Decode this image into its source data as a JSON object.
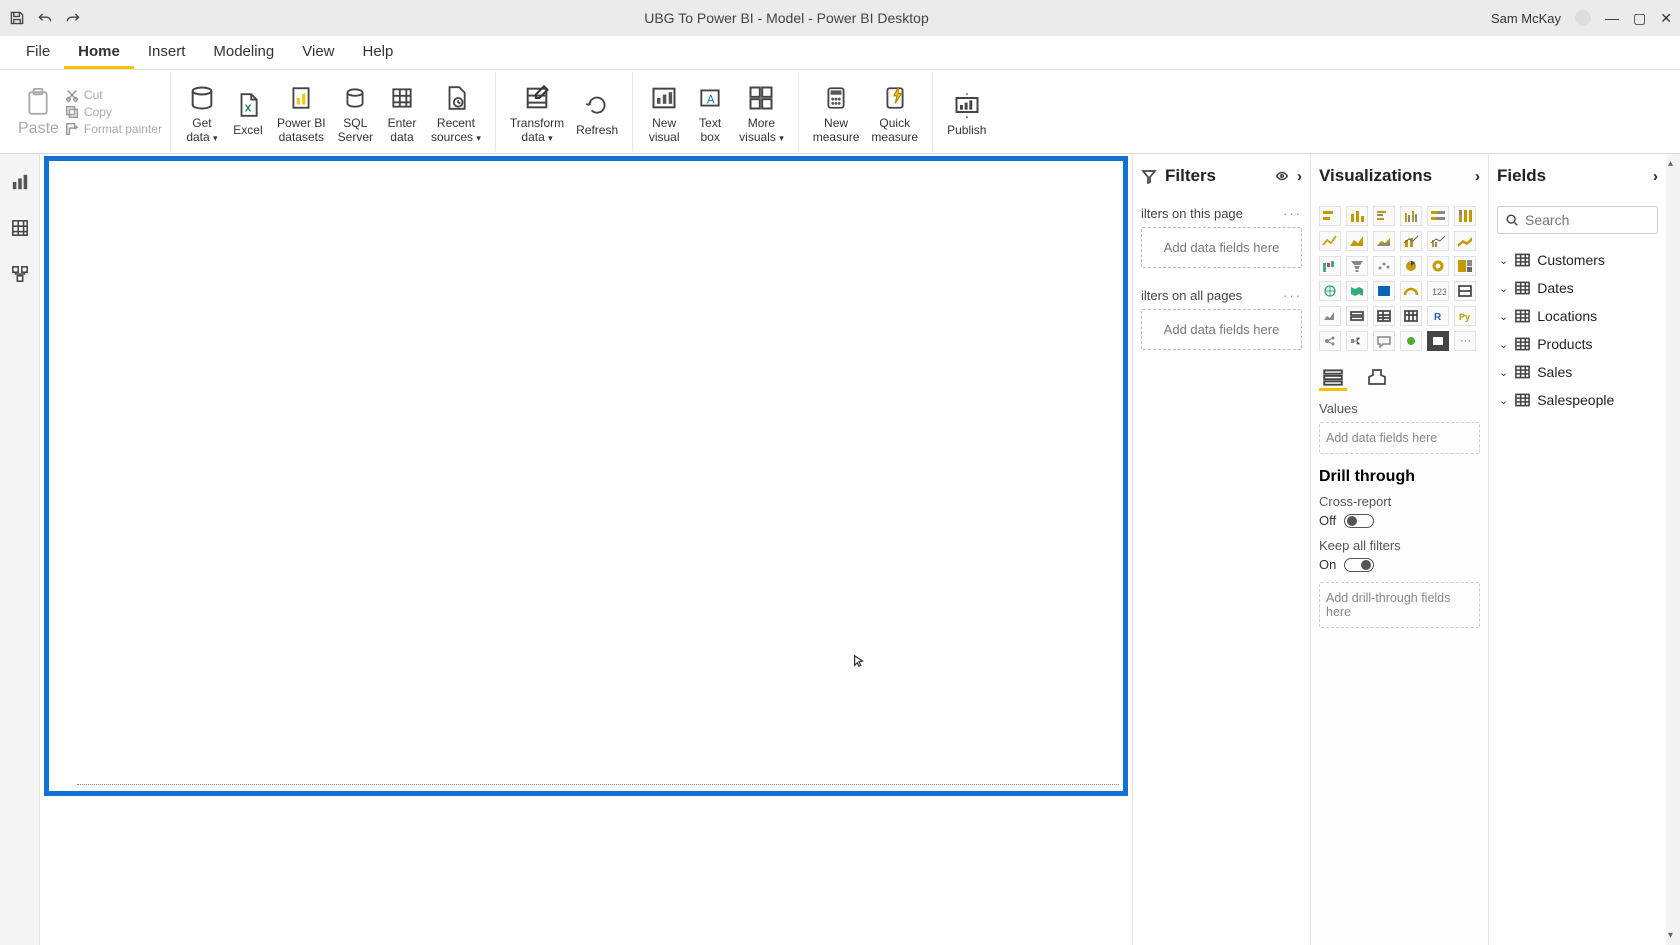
{
  "titlebar": {
    "title": "UBG To Power BI - Model - Power BI Desktop",
    "user": "Sam McKay"
  },
  "menu": {
    "tabs": [
      "File",
      "Home",
      "Insert",
      "Modeling",
      "View",
      "Help"
    ],
    "active": "Home"
  },
  "ribbon": {
    "paste": "Paste",
    "cut": "Cut",
    "copy": "Copy",
    "format_painter": "Format painter",
    "get_data": "Get\ndata",
    "excel": "Excel",
    "pbi_datasets": "Power BI\ndatasets",
    "sql_server": "SQL\nServer",
    "enter_data": "Enter\ndata",
    "recent_sources": "Recent\nsources",
    "transform_data": "Transform\ndata",
    "refresh": "Refresh",
    "new_visual": "New\nvisual",
    "text_box": "Text\nbox",
    "more_visuals": "More\nvisuals",
    "new_measure": "New\nmeasure",
    "quick_measure": "Quick\nmeasure",
    "publish": "Publish"
  },
  "filters": {
    "title": "Filters",
    "page_label": "ilters on this page",
    "add_here": "Add data fields here",
    "all_label": "ilters on all pages"
  },
  "viz": {
    "title": "Visualizations",
    "values_label": "Values",
    "add_here": "Add data fields here",
    "drill_title": "Drill through",
    "cross_report": "Cross-report",
    "cross_state": "Off",
    "keep_filters": "Keep all filters",
    "keep_state": "On",
    "drill_slot": "Add drill-through fields here"
  },
  "fields": {
    "title": "Fields",
    "search_placeholder": "Search",
    "tables": [
      "Customers",
      "Dates",
      "Locations",
      "Products",
      "Sales",
      "Salespeople"
    ]
  }
}
